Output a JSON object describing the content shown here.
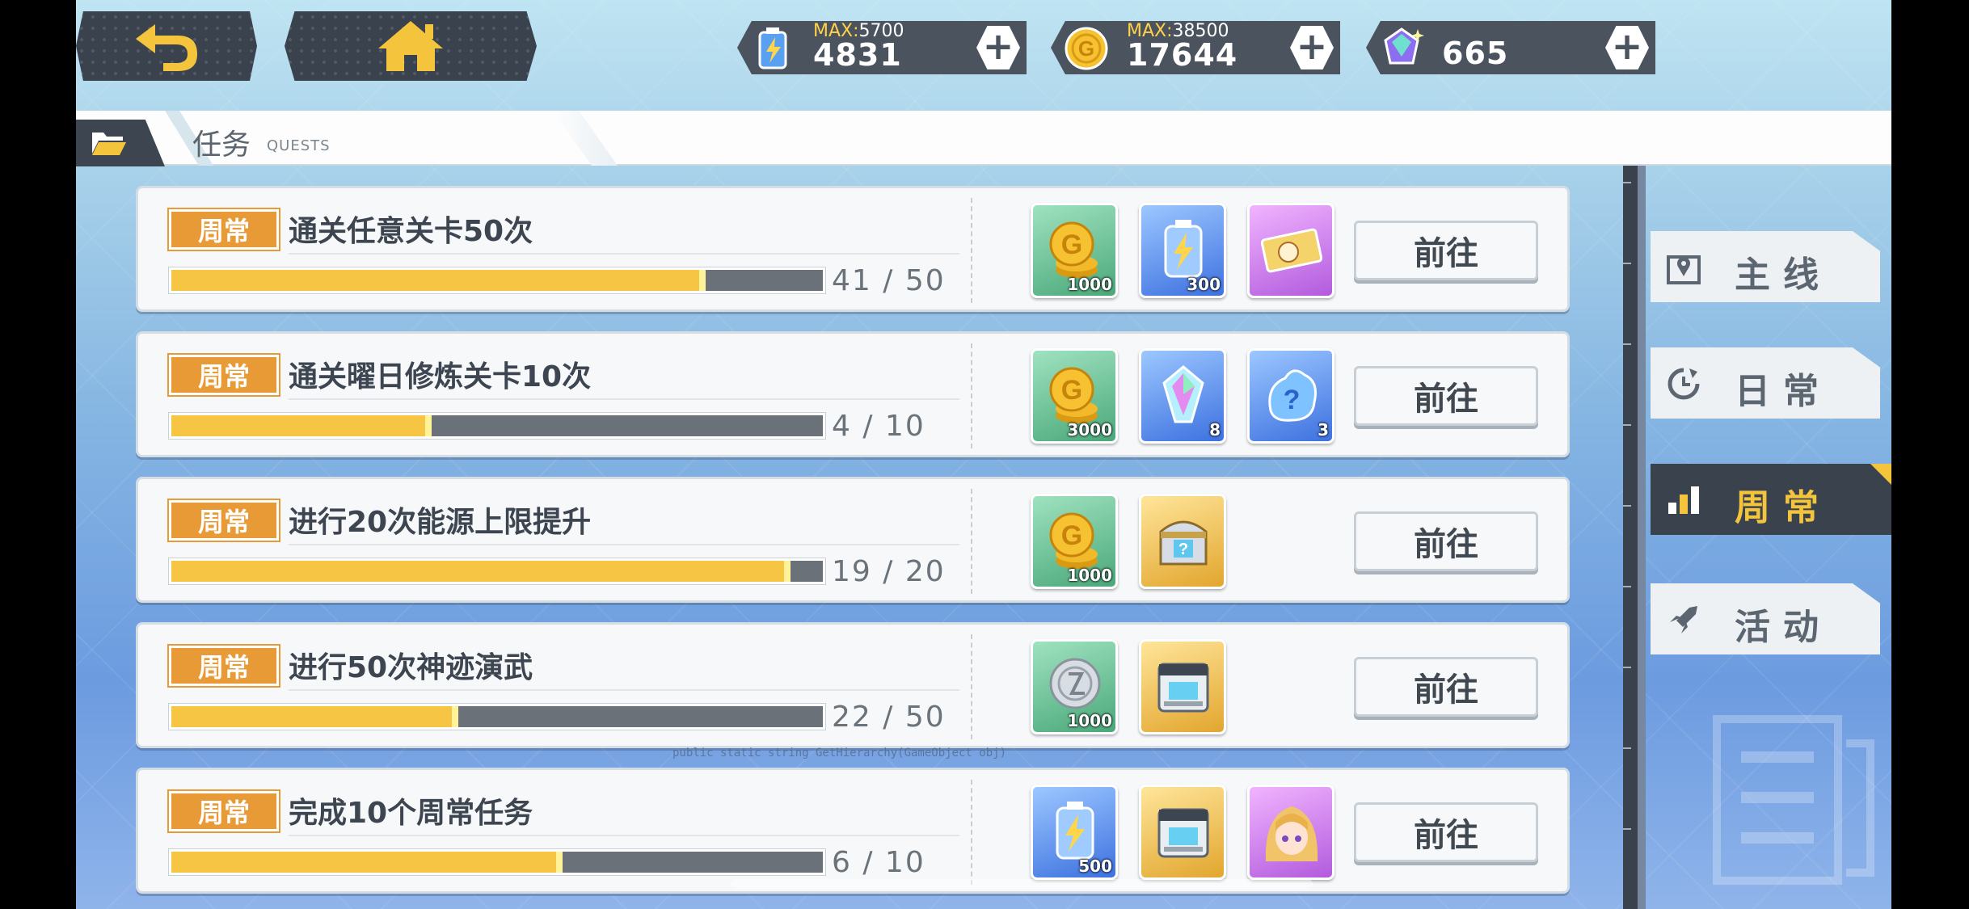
{
  "header": {
    "energy": {
      "max_label": "MAX:",
      "max_value": "5700",
      "value": "4831"
    },
    "gold": {
      "max_label": "MAX:",
      "max_value": "38500",
      "value": "17644"
    },
    "gems": {
      "value": "665"
    }
  },
  "page": {
    "title": "任务",
    "subtitle": "QUESTS"
  },
  "quests": [
    {
      "badge": "周常",
      "text": "通关任意关卡50次",
      "progress_text": "41 / 50",
      "progress": 0.82,
      "button": "前往",
      "rewards": [
        {
          "type": "gold-coins",
          "frame": "green",
          "qty": "1000"
        },
        {
          "type": "energy-battery",
          "frame": "blue",
          "qty": "300"
        },
        {
          "type": "ticket",
          "frame": "purple",
          "qty": ""
        }
      ]
    },
    {
      "badge": "周常",
      "text": "通关曜日修炼关卡10次",
      "progress_text": "4 / 10",
      "progress": 0.4,
      "button": "前往",
      "rewards": [
        {
          "type": "gold-coins",
          "frame": "green",
          "qty": "3000"
        },
        {
          "type": "crystal",
          "frame": "blue",
          "qty": "8"
        },
        {
          "type": "mystery-blob",
          "frame": "blue",
          "qty": "3"
        }
      ]
    },
    {
      "badge": "周常",
      "text": "进行20次能源上限提升",
      "progress_text": "19 / 20",
      "progress": 0.95,
      "button": "前往",
      "rewards": [
        {
          "type": "gold-coins",
          "frame": "green",
          "qty": "1000"
        },
        {
          "type": "mystery-chest",
          "frame": "gold",
          "qty": ""
        }
      ]
    },
    {
      "badge": "周常",
      "text": "进行50次神迹演武",
      "progress_text": "22 / 50",
      "progress": 0.44,
      "button": "前往",
      "rewards": [
        {
          "type": "silver-coin",
          "frame": "green",
          "qty": "1000"
        },
        {
          "type": "supply-box",
          "frame": "gold",
          "qty": ""
        }
      ]
    },
    {
      "badge": "周常",
      "text": "完成10个周常任务",
      "progress_text": "6 / 10",
      "progress": 0.6,
      "button": "前往",
      "rewards": [
        {
          "type": "energy-battery",
          "frame": "blue",
          "qty": "500"
        },
        {
          "type": "supply-box",
          "frame": "gold",
          "qty": ""
        },
        {
          "type": "character-portrait",
          "frame": "purple",
          "qty": ""
        }
      ]
    }
  ],
  "side_tabs": [
    {
      "label": "主线",
      "icon": "map-pin-icon",
      "active": false
    },
    {
      "label": "日常",
      "icon": "refresh-icon",
      "active": false
    },
    {
      "label": "周常",
      "icon": "bar-chart-icon",
      "active": true
    },
    {
      "label": "活动",
      "icon": "rocket-icon",
      "active": false
    }
  ],
  "debug_overlay": "public static string GetHierarchy(GameObject obj)",
  "colors": {
    "accent_yellow": "#f4c53c",
    "badge_orange": "#e89a36",
    "dark_panel": "#3a434d"
  }
}
